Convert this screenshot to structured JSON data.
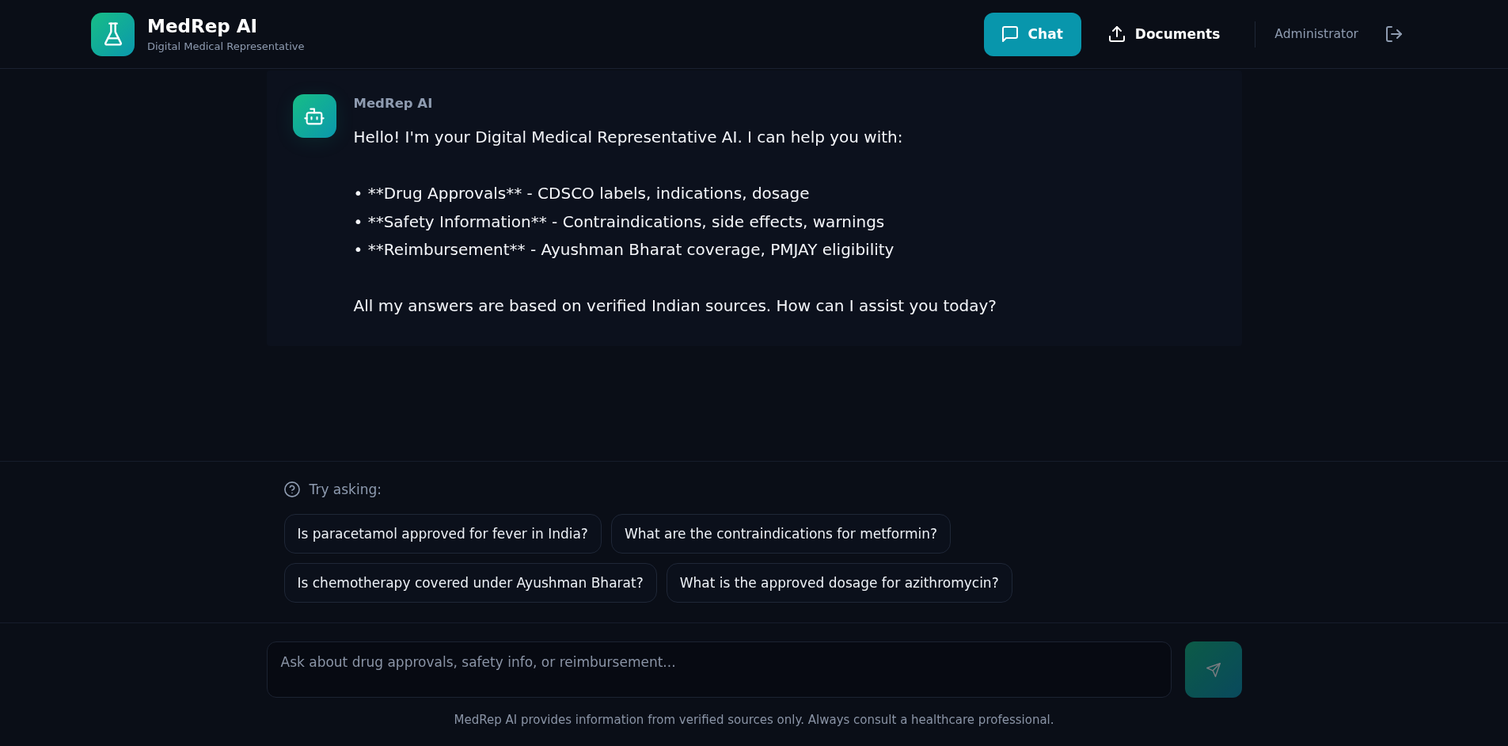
{
  "header": {
    "title": "MedRep AI",
    "subtitle": "Digital Medical Representative",
    "nav": [
      {
        "label": "Chat",
        "selected": true
      },
      {
        "label": "Documents",
        "selected": false
      }
    ],
    "user": "Administrator"
  },
  "messages": [
    {
      "sender": "MedRep AI",
      "text": "Hello! I'm your Digital Medical Representative AI. I can help you with:\n\n• **Drug Approvals** - CDSCO labels, indications, dosage\n• **Safety Information** - Contraindications, side effects, warnings\n• **Reimbursement** - Ayushman Bharat coverage, PMJAY eligibility\n\nAll my answers are based on verified Indian sources. How can I assist you today?"
    }
  ],
  "suggestions": {
    "title": "Try asking:",
    "items": [
      "Is paracetamol approved for fever in India?",
      "What are the contraindications for metformin?",
      "Is chemotherapy covered under Ayushman Bharat?",
      "What is the approved dosage for azithromycin?"
    ]
  },
  "composer": {
    "placeholder": "Ask about drug approvals, safety info, or reimbursement...",
    "send_disabled": true
  },
  "footer": "MedRep AI provides information from verified sources only. Always consult a healthcare professional."
}
